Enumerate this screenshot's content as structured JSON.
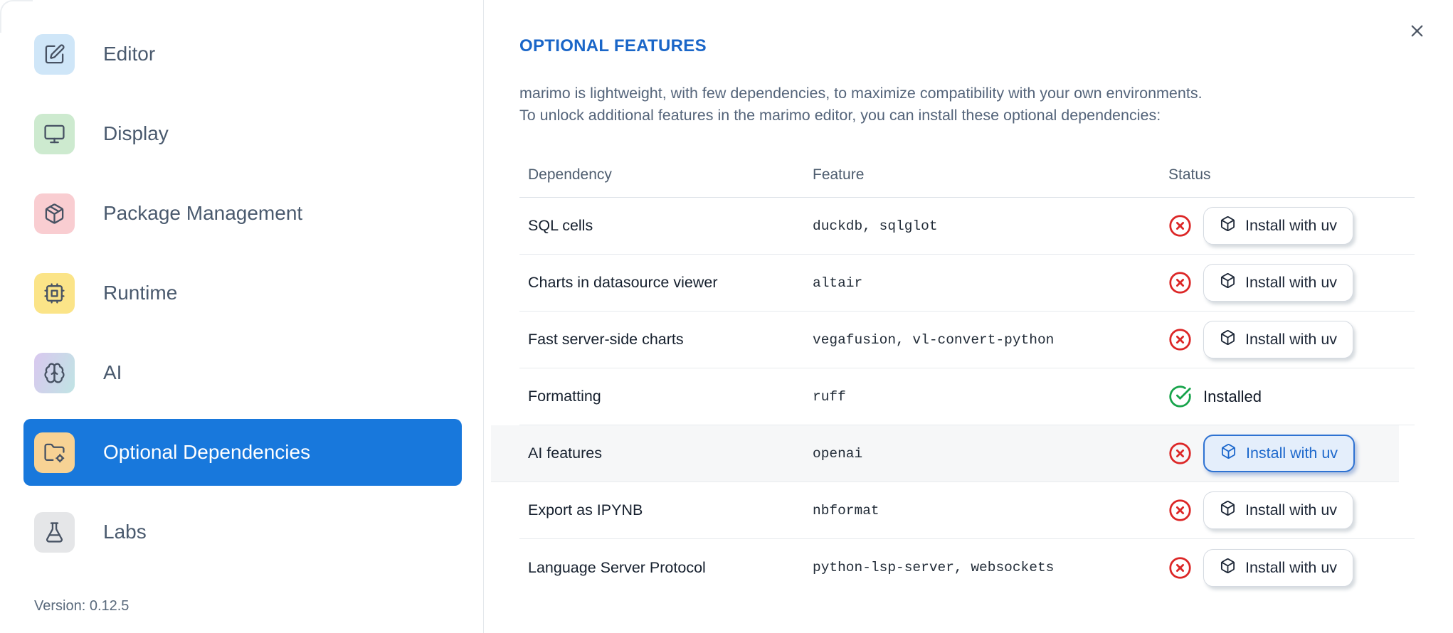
{
  "dialog": {
    "close_icon": "close-x"
  },
  "sidebar": {
    "items": [
      {
        "label": "Editor",
        "icon": "square-pen",
        "bg": "#cfe6f8",
        "selected": false
      },
      {
        "label": "Display",
        "icon": "monitor",
        "bg": "#cdeacf",
        "selected": false
      },
      {
        "label": "Package Management",
        "icon": "package",
        "bg": "#f9cdd1",
        "selected": false
      },
      {
        "label": "Runtime",
        "icon": "cpu",
        "bg": "#fbe488",
        "selected": false
      },
      {
        "label": "AI",
        "icon": "brain",
        "bg": "linear-gradient(110deg,#d9c8ef,#c0e4e4)",
        "selected": false
      },
      {
        "label": "Optional Dependencies",
        "icon": "folder-cog",
        "bg": "#f7d294",
        "selected": true
      },
      {
        "label": "Labs",
        "icon": "flask",
        "bg": "#e5e6e8",
        "selected": false
      }
    ],
    "version_label": "Version: 0.12.5"
  },
  "main": {
    "title": "OPTIONAL FEATURES",
    "description_line1": "marimo is lightweight, with few dependencies, to maximize compatibility with your own environments.",
    "description_line2": "To unlock additional features in the marimo editor, you can install these optional dependencies:",
    "table": {
      "columns": [
        "Dependency",
        "Feature",
        "Status"
      ],
      "install_button_label": "Install with uv",
      "installed_label": "Installed",
      "rows": [
        {
          "dependency": "SQL cells",
          "feature": "duckdb, sqlglot",
          "installed": false,
          "highlighted": false,
          "focused": false
        },
        {
          "dependency": "Charts in datasource viewer",
          "feature": "altair",
          "installed": false,
          "highlighted": false,
          "focused": false
        },
        {
          "dependency": "Fast server-side charts",
          "feature": "vegafusion, vl-convert-python",
          "installed": false,
          "highlighted": false,
          "focused": false
        },
        {
          "dependency": "Formatting",
          "feature": "ruff",
          "installed": true,
          "highlighted": false,
          "focused": false
        },
        {
          "dependency": "AI features",
          "feature": "openai",
          "installed": false,
          "highlighted": true,
          "focused": true
        },
        {
          "dependency": "Export as IPYNB",
          "feature": "nbformat",
          "installed": false,
          "highlighted": false,
          "focused": false
        },
        {
          "dependency": "Language Server Protocol",
          "feature": "python-lsp-server, websockets",
          "installed": false,
          "highlighted": false,
          "focused": false
        }
      ]
    }
  },
  "colors": {
    "accent_blue": "#1878dc",
    "title_blue": "#1a66c8",
    "error_red": "#dc2626",
    "success_green": "#16a34a"
  }
}
